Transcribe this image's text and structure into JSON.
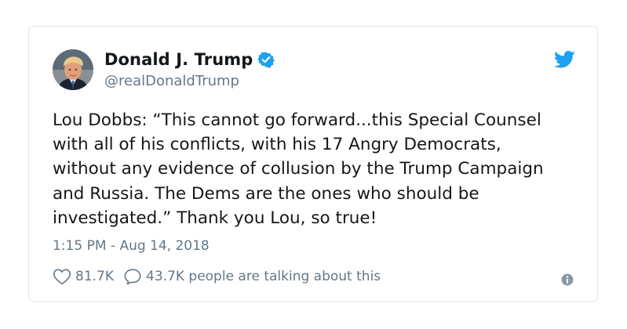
{
  "tweet": {
    "display_name": "Donald J. Trump",
    "handle": "@realDonaldTrump",
    "verified": true,
    "text": "Lou Dobbs: “This cannot go forward...this Special Counsel with all of his conflicts, with his 17 Angry Democrats, without any evidence of collusion by the Trump Campaign and Russia. The Dems are the ones who should be investigated.” Thank you Lou, so true!",
    "timestamp": "1:15 PM - Aug 14, 2018",
    "likes": "81.7K",
    "replies_text": "43.7K people are talking about this"
  },
  "icons": {
    "brand": "twitter-bird-icon",
    "verified": "verified-badge-icon",
    "like": "heart-icon",
    "reply": "speech-bubble-icon",
    "info": "info-icon"
  },
  "colors": {
    "brand_blue": "#1da1f2",
    "text_primary": "#14171a",
    "text_secondary": "#657786",
    "border": "#e1e8ed"
  }
}
